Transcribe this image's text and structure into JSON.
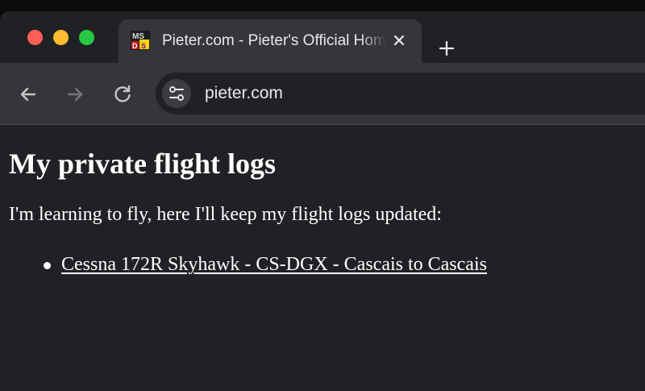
{
  "window": {
    "controls": {
      "close_color": "#ff5f57",
      "minimize_color": "#febc2e",
      "maximize_color": "#28c840"
    }
  },
  "tab": {
    "title": "Pieter.com - Pieter's Official Homepage",
    "favicon": "ms-dos-icon",
    "close_icon": "close-icon"
  },
  "new_tab": {
    "icon": "plus-icon"
  },
  "toolbar": {
    "back_icon": "arrow-left-icon",
    "forward_icon": "arrow-right-icon",
    "reload_icon": "reload-icon",
    "site_info_icon": "tune-icon",
    "url": "pieter.com"
  },
  "page": {
    "title": "My private flight logs",
    "intro": "I'm learning to fly, here I'll keep my flight logs updated:",
    "logs": [
      {
        "label": "Cessna 172R Skyhawk - CS-DGX - Cascais to Cascais"
      }
    ]
  },
  "colors": {
    "tabstrip_bg": "#202124",
    "toolbar_bg": "#35363a",
    "page_bg": "#202124",
    "text": "#ffffff"
  }
}
